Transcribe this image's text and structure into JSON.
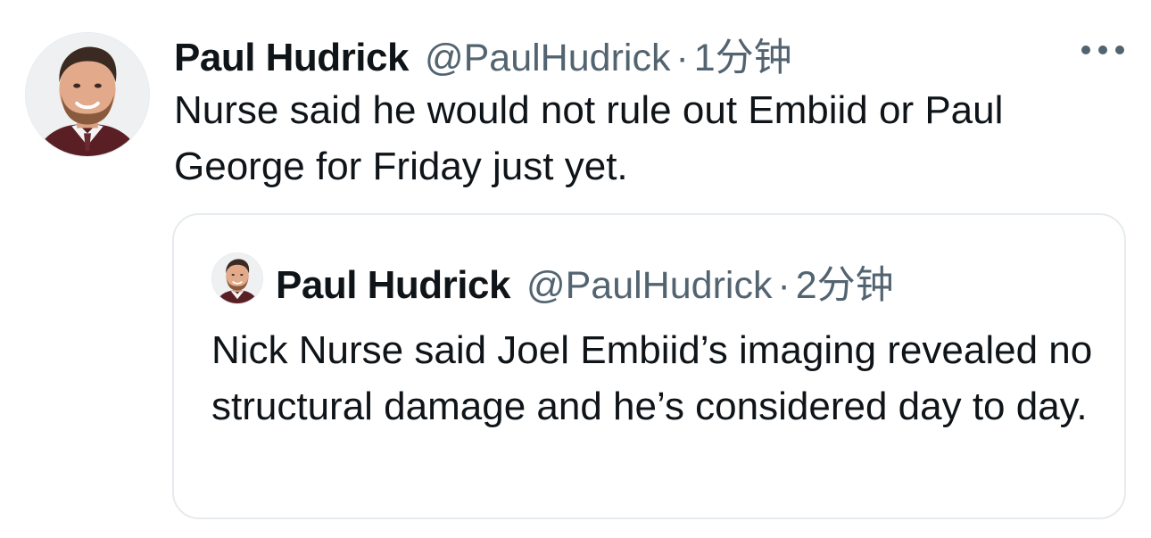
{
  "tweet": {
    "author_name": "Paul Hudrick",
    "author_handle": "@PaulHudrick",
    "separator": "·",
    "time": "1分钟",
    "text": "Nurse said he would not rule out Embiid or Paul George for Friday just yet.",
    "avatar_icon": "profile-photo",
    "more_icon": "more-horizontal-icon"
  },
  "quoted_tweet": {
    "author_name": "Paul Hudrick",
    "author_handle": "@PaulHudrick",
    "separator": "·",
    "time": "2分钟",
    "text": "Nick Nurse said Joel Embiid’s imaging revealed no structural damage and he’s considered day to day.",
    "avatar_icon": "profile-photo"
  },
  "colors": {
    "text_primary": "#0f1419",
    "text_secondary": "#536471",
    "quote_border": "#e6ebef",
    "background": "#ffffff"
  }
}
